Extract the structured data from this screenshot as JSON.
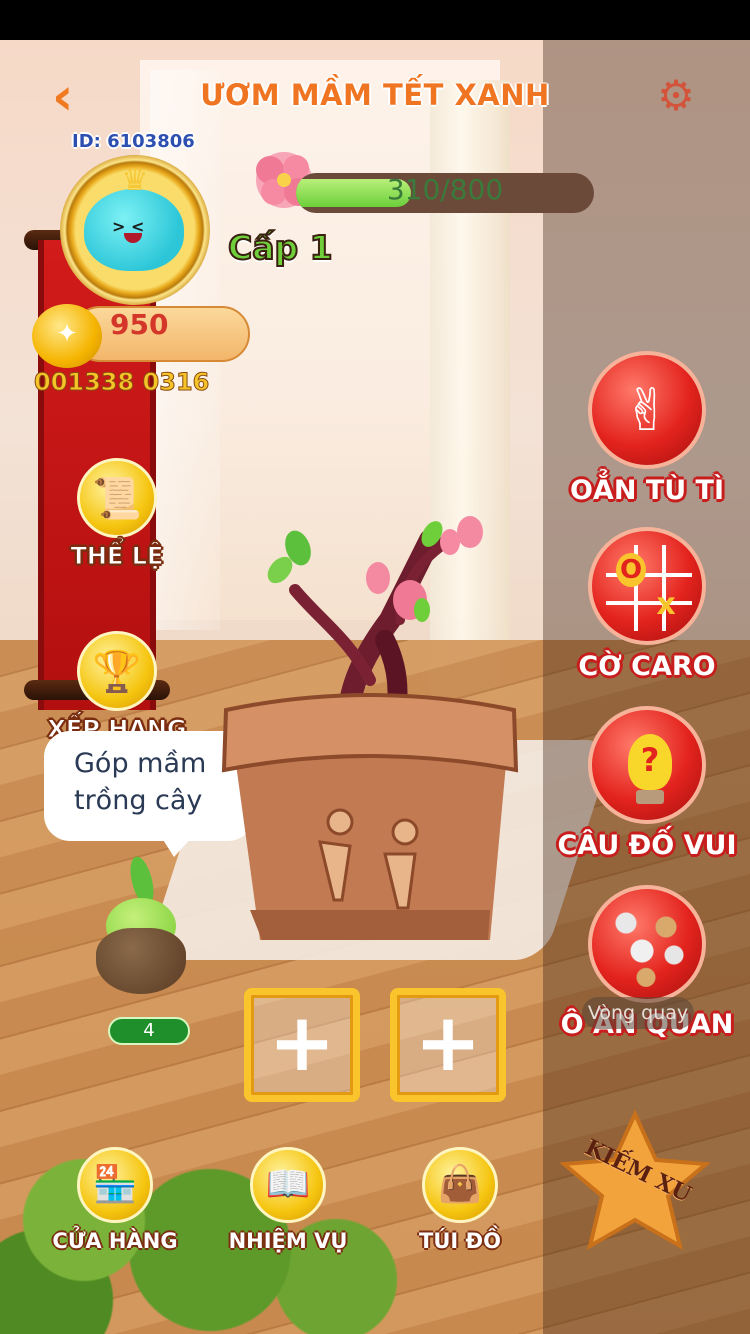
{
  "header": {
    "title": "ƯƠM MẦM TẾT XANH",
    "back_icon": "chevron-left-icon",
    "settings_icon": "gear-icon"
  },
  "profile": {
    "user_id": "ID: 6103806",
    "coins": "950",
    "phone": "001338 0316",
    "level_label": "Cấp 1",
    "progress_text": "310/800",
    "progress_fraction": 0.3875
  },
  "left_menu": [
    {
      "label": "THỂ LỆ",
      "icon": "scroll-icon"
    },
    {
      "label": "XẾP HẠNG",
      "icon": "trophy-icon"
    }
  ],
  "bubble": {
    "line1": "Góp mầm",
    "line2": "trồng cây"
  },
  "seed": {
    "count": "4"
  },
  "slots": [
    {
      "symbol": "+"
    },
    {
      "symbol": "+"
    }
  ],
  "games": [
    {
      "label": "OẲN TÙ TÌ",
      "icon": "hand-victory-icon"
    },
    {
      "label": "CỜ CARO",
      "icon": "tic-tac-toe-icon"
    },
    {
      "label": "CÂU ĐỐ VUI",
      "icon": "lightbulb-icon"
    },
    {
      "label": "Ô ĂN QUAN",
      "icon": "stones-icon"
    }
  ],
  "wheel": {
    "label": "Vòng quay"
  },
  "bottom_nav": [
    {
      "label": "CỬA HÀNG",
      "icon": "shop-icon"
    },
    {
      "label": "NHIỆM VỤ",
      "icon": "book-icon"
    },
    {
      "label": "TÚI ĐỒ",
      "icon": "bag-icon"
    }
  ],
  "earn": {
    "label": "KIẾM XU"
  },
  "colors": {
    "accent": "#f07522",
    "game_red": "#e3231d",
    "gold": "#f5c510",
    "progress_green": "#6bcf3a"
  }
}
